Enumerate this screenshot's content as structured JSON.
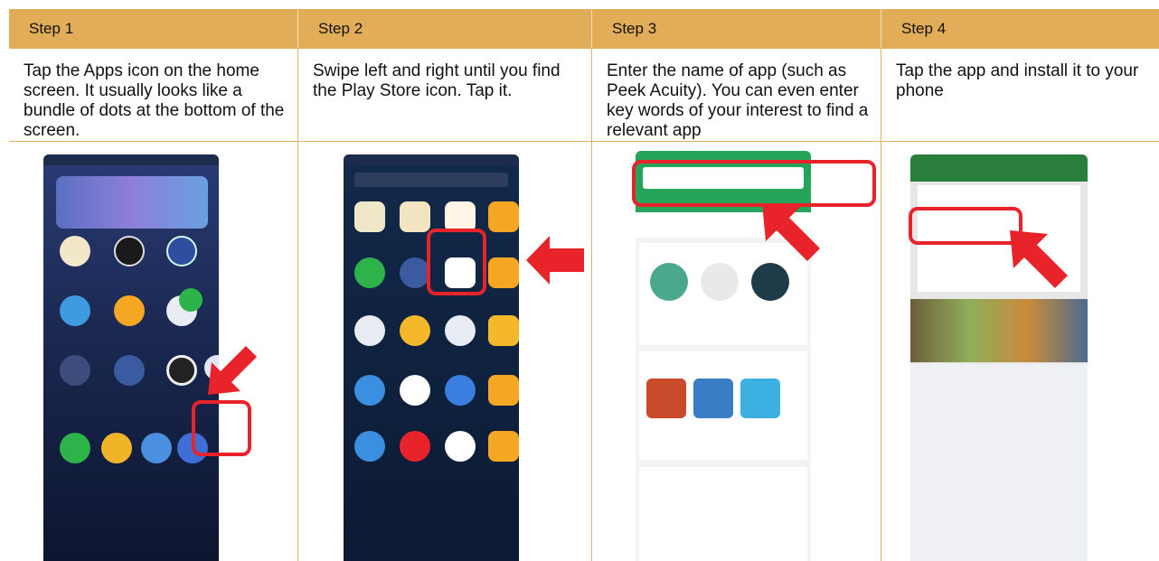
{
  "steps": [
    {
      "title": "Step 1",
      "description": "Tap the Apps icon on the home screen. It usually looks like a bundle of dots at the bottom of the screen."
    },
    {
      "title": "Step 2",
      "description": "Swipe left and right until you find the Play Store icon. Tap it."
    },
    {
      "title": "Step 3",
      "description": "Enter the name of app (such as Peek Acuity). You can even enter key words of your interest to find a relevant app"
    },
    {
      "title": "Step 4",
      "description": "Tap the app and install it to your phone"
    }
  ],
  "colors": {
    "header": "#e2ad58",
    "border": "#e2b35e",
    "highlight": "#e8232a"
  }
}
